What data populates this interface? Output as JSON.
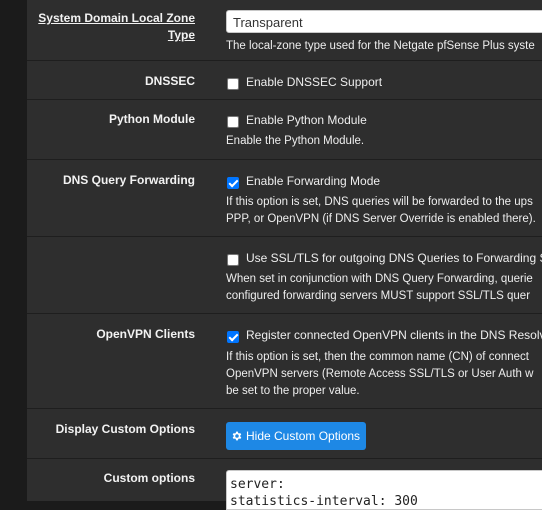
{
  "rows": {
    "local_zone": {
      "label": "System Domain Local Zone Type",
      "label_line1": "System Domain Local Zone",
      "label_line2": "Type",
      "select_value": "Transparent",
      "help": "The local-zone type used for the Netgate pfSense Plus syste"
    },
    "dnssec": {
      "label": "DNSSEC",
      "checkbox_label": "Enable DNSSEC Support",
      "checked": false
    },
    "python_module": {
      "label": "Python Module",
      "checkbox_label": "Enable Python Module",
      "checked": false,
      "help": "Enable the Python Module."
    },
    "dns_query_forwarding": {
      "label": "DNS Query Forwarding",
      "checkbox_label": "Enable Forwarding Mode",
      "checked": true,
      "help_line1": "If this option is set, DNS queries will be forwarded to the ups",
      "help_line2": "PPP, or OpenVPN (if DNS Server Override is enabled there)."
    },
    "ssl_tls": {
      "checkbox_label": "Use SSL/TLS for outgoing DNS Queries to Forwarding S",
      "checked": false,
      "help_line1": "When set in conjunction with DNS Query Forwarding, querie",
      "help_line2": "configured forwarding servers MUST support SSL/TLS quer"
    },
    "openvpn_clients": {
      "label": "OpenVPN Clients",
      "checkbox_label": "Register connected OpenVPN clients in the DNS Resolve",
      "checked": true,
      "help_line1": "If this option is set, then the common name (CN) of connect",
      "help_line2": "OpenVPN servers (Remote Access SSL/TLS or User Auth w",
      "help_line3": "be set to the proper value."
    },
    "display_custom": {
      "label": "Display Custom Options",
      "button_label": "Hide Custom Options",
      "button_icon": "gear-icon"
    },
    "custom_options": {
      "label": "Custom options",
      "line1": "server:",
      "line2": "statistics-interval: 300"
    }
  },
  "colors": {
    "background": "#2e2e2e",
    "text": "#eeeeee",
    "checkbox_checked": "#0075ff",
    "button": "#1e88e5"
  }
}
